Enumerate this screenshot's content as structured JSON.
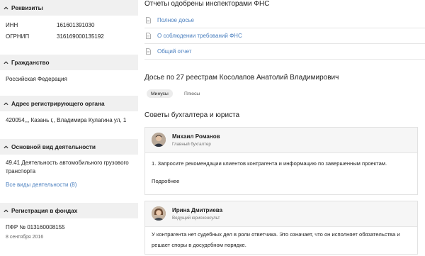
{
  "left": {
    "requisites": {
      "title": "Реквизиты",
      "rows": [
        {
          "label": "ИНН",
          "value": "161601391030"
        },
        {
          "label": "ОГРНИП",
          "value": "316169000135192"
        }
      ]
    },
    "citizenship": {
      "title": "Гражданство",
      "value": "Российская Федерация"
    },
    "registration_address": {
      "title": "Адрес регистрирующего органа",
      "value": "420054,,, Казань г,, Владимира Кулагина ул, 1"
    },
    "main_activity": {
      "title": "Основной вид деятельности",
      "value_line1": "49.41 Деятельность автомобильного грузового",
      "value_line2": "транспорта",
      "all_link": "Все виды деятельности (8)"
    },
    "funds_registration": {
      "title": "Регистрация в фондах",
      "pfr": "ПФР № 013160008155",
      "date": "8 сентября 2016"
    }
  },
  "right": {
    "fns_reports": {
      "title": "Отчеты одобрены инспекторами ФНС",
      "items": [
        "Полное досье",
        "О соблюдении требований ФНС",
        "Общий отчет"
      ]
    },
    "dossier": {
      "title": "Досье по 27 реестрам Косолапов Анатолий Владимирович",
      "tabs": [
        "Минусы",
        "Плюсы"
      ]
    },
    "advice": {
      "title": "Советы бухгалтера и юриста",
      "cards": [
        {
          "name": "Михаил Романов",
          "role": "Главный бухгалтер",
          "text": "1. Запросите рекомендации клиентов контрагента и информацию по завершенным проектам.",
          "more": "Подробнее"
        },
        {
          "name": "Ирина Дмитриева",
          "role": "Ведущий юрисконсульт",
          "text_line1": "У контрагента нет судебных дел в роли ответчика. Это означает, что он исполняет обязательства и",
          "text_line2": "решает споры в досудебном порядке."
        }
      ]
    }
  },
  "icons": {
    "section_toggle": "chevron-up-icon",
    "report": "document-icon"
  },
  "colors": {
    "link": "#4a7fbf",
    "section_bg": "#f0f0f0",
    "card_head_bg": "#f6f6f6"
  }
}
